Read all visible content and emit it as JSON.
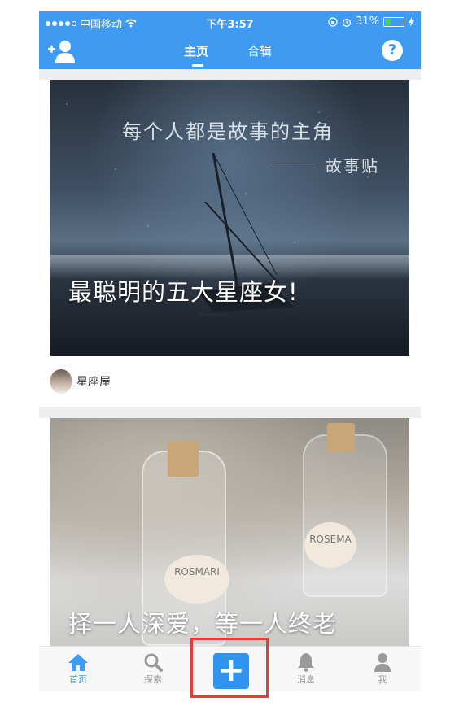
{
  "status_bar": {
    "carrier": "中国移动",
    "time": "下午3:57",
    "battery": "31%",
    "battery_level": 0.31
  },
  "header": {
    "tabs": [
      {
        "label": "主页",
        "active": true
      },
      {
        "label": "合辑",
        "active": false
      }
    ],
    "help_label": "?"
  },
  "cards": [
    {
      "image_text_main": "每个人都是故事的主角",
      "image_text_sub": "故事贴",
      "title": "最聪明的五大星座女!",
      "author": "星座屋"
    },
    {
      "title": "择一人深爱，等一人终老",
      "bottle_label_left": "ROSMARI",
      "bottle_label_right": "ROSEMA"
    }
  ],
  "tabbar": {
    "items": [
      {
        "label": "首页",
        "icon": "home-icon",
        "active": true
      },
      {
        "label": "探索",
        "icon": "search-icon",
        "active": false
      },
      {
        "label": "消息",
        "icon": "bell-icon",
        "active": false
      },
      {
        "label": "我",
        "icon": "person-icon",
        "active": false
      }
    ],
    "create_icon": "plus-icon",
    "create_glyph": "+"
  },
  "colors": {
    "brand": "#3f9bf2",
    "highlight": "#e0403a",
    "tab_inactive": "#9a9a9a"
  }
}
